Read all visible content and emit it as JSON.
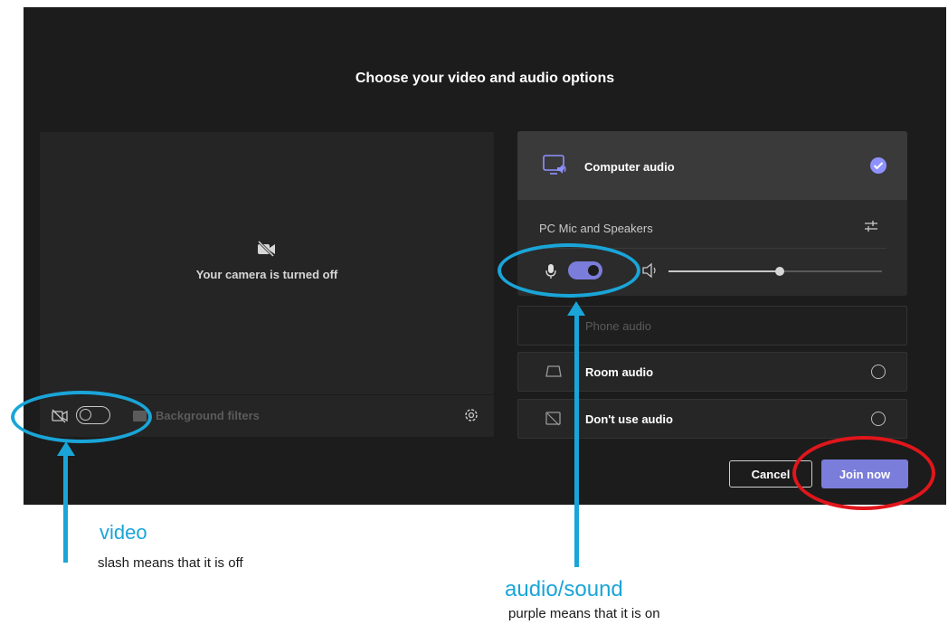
{
  "dialog": {
    "title": "Choose your video and audio options"
  },
  "video": {
    "camera_status": "Your camera is turned off",
    "background_filters_label": "Background filters",
    "camera_toggle_on": false
  },
  "audio": {
    "computer_audio_label": "Computer audio",
    "device_label": "PC Mic and Speakers",
    "mic_toggle_on": true,
    "volume_level": 0.52,
    "phone_audio_label": "Phone audio",
    "room_audio_label": "Room audio",
    "no_audio_label": "Don't use audio"
  },
  "buttons": {
    "cancel_label": "Cancel",
    "join_label": "Join now"
  },
  "annotations": {
    "video_title": "video",
    "video_note": "slash means that it is off",
    "audio_title": "audio/sound",
    "audio_note": "purple means that it is on"
  },
  "colors": {
    "accent": "#7b7ddb",
    "annotation_blue": "#1aa5d8",
    "annotation_red": "#e0161b",
    "background": "#1c1c1c"
  }
}
